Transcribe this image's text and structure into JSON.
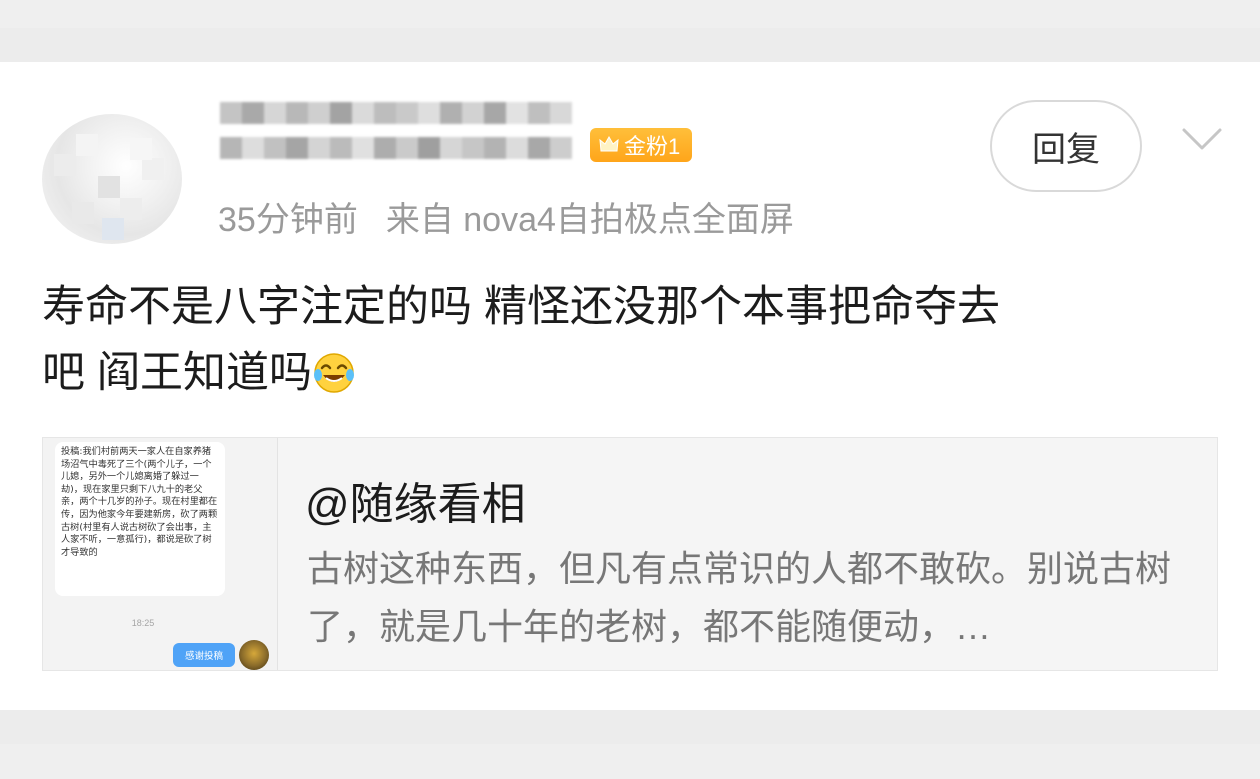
{
  "comment": {
    "badge_label": "金粉1",
    "time": "35分钟前",
    "source": "来自 nova4自拍极点全面屏",
    "reply_label": "回复",
    "text_line1": "寿命不是八字注定的吗 精怪还没那个本事把命夺去",
    "text_line2": "吧 阎王知道吗",
    "emoji": "laughing-crying-emoji"
  },
  "share": {
    "title": "@随缘看相",
    "description": "古树这种东西，但凡有点常识的人都不敢砍。别说古树了，就是几十年的老树，都不能随便动，…",
    "thumbnail": {
      "message": "投稿:我们村前两天一家人在自家养猪场沼气中毒死了三个(两个儿子，一个儿媳，另外一个儿媳离婚了躲过一劫)，现在家里只剩下八九十的老父亲，两个十几岁的孙子。现在村里都在传，因为他家今年要建新房，砍了两颗古树(村里有人说古树砍了会出事，主人家不听，一意孤行)，都说是砍了树才导致的",
      "time": "18:25",
      "thanks_label": "感谢投稿"
    }
  },
  "colors": {
    "badge": "#ffa51a",
    "meta_text": "#9a9a9a",
    "body_text": "#1c1c1c",
    "thanks_bubble": "#4fa3f7"
  }
}
